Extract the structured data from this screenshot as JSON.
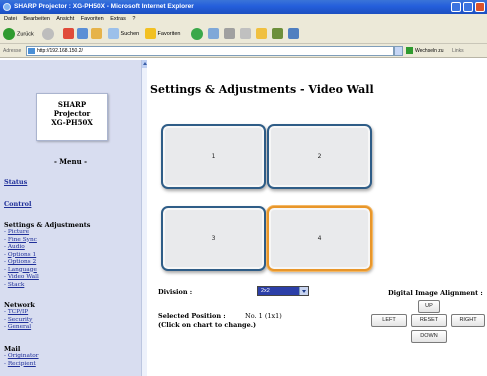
{
  "browser": {
    "title": "SHARP Projector : XG-PH50X - Microsoft Internet Explorer",
    "menu": [
      "Datei",
      "Bearbeiten",
      "Ansicht",
      "Favoriten",
      "Extras",
      "?"
    ],
    "toolbar": {
      "back_label": "Zurück",
      "search_label": "Suchen",
      "favorites_label": "Favoriten"
    },
    "address": {
      "label": "Adresse",
      "value": "http://192.168.150.2/",
      "go_label": "Wechseln zu",
      "links_label": "Links"
    }
  },
  "sidebar": {
    "brand_lines": [
      "SHARP",
      "Projector",
      "XG-PH50X"
    ],
    "menu_title": "- Menu -",
    "status_link": "Status",
    "control_link": "Control",
    "settings_section": {
      "title": "Settings & Adjustments",
      "items": [
        "Picture",
        "Fine Sync",
        "Audio",
        "Options 1",
        "Options 2",
        "Language",
        "Video Wall",
        "Stack"
      ]
    },
    "network_section": {
      "title": "Network",
      "items": [
        "TCP/IP",
        "Security",
        "General"
      ]
    },
    "mail_section": {
      "title": "Mail",
      "items": [
        "Originator",
        "Recipient"
      ]
    }
  },
  "main": {
    "title": "Settings & Adjustments - Video Wall",
    "grid_tiles": [
      "1",
      "2",
      "3",
      "4"
    ],
    "selected_tile": "4",
    "division_label": "Division :",
    "division_value": "2x2",
    "selected_position_label": "Selected Position :",
    "selected_position_value": "No. 1 (1x1)",
    "click_hint": "(Click on chart to change.)",
    "alignment_label": "Digital Image Alignment :",
    "buttons": {
      "up": "UP",
      "left": "LEFT",
      "reset": "RESET",
      "right": "RIGHT",
      "down": "DOWN"
    }
  },
  "colors": {
    "tile_border": "#2f5d87",
    "tile_selected_border": "#e8962a",
    "link": "#1f2f99",
    "sidebar_bg": "#d8ddf0"
  }
}
